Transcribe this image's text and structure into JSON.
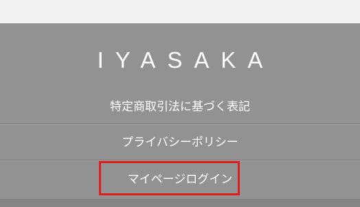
{
  "footer": {
    "logo_text": "IYASAKA",
    "links": [
      {
        "label": "特定商取引法に基づく表記"
      },
      {
        "label": "プライバシーポリシー"
      },
      {
        "label": "マイページログイン"
      }
    ]
  },
  "colors": {
    "footer_background": "#929292",
    "page_background": "#f3f3f3",
    "text": "#ffffff",
    "highlight": "#e01b1b"
  }
}
